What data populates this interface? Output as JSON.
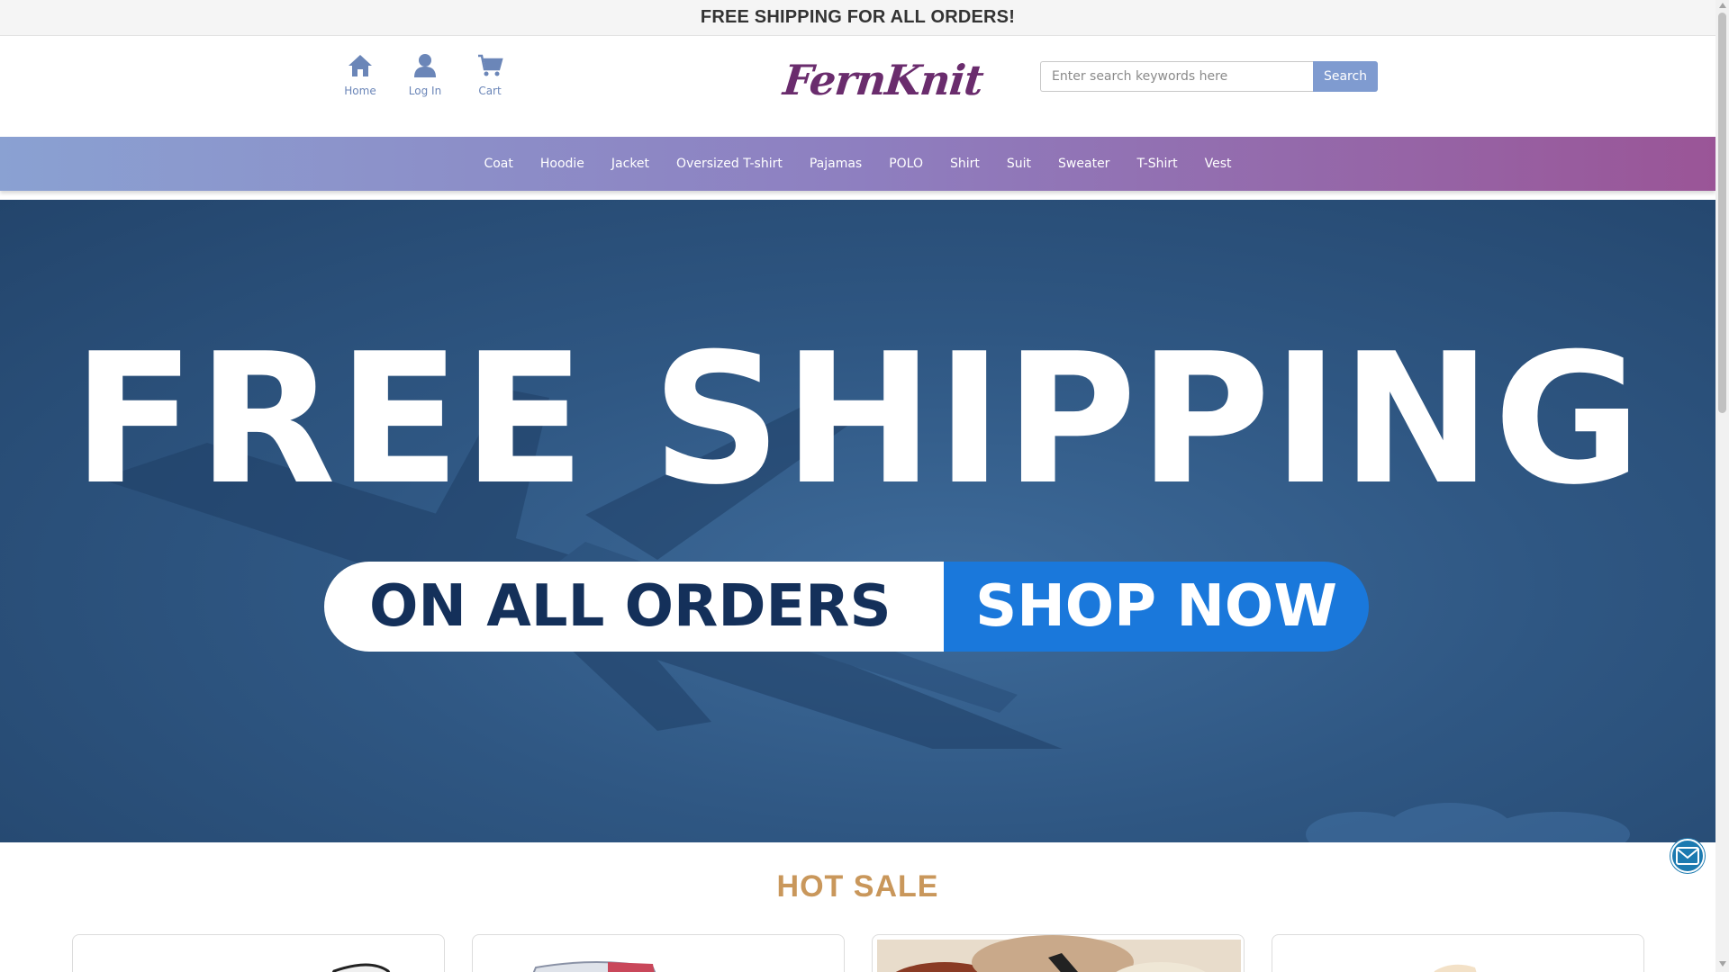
{
  "announcement": "FREE SHIPPING FOR ALL ORDERS!",
  "nav_icons": [
    {
      "label": "Home",
      "icon": "home-icon"
    },
    {
      "label": "Log In",
      "icon": "user-icon"
    },
    {
      "label": "Cart",
      "icon": "cart-icon"
    }
  ],
  "brand": {
    "logo_text": "FernKnit"
  },
  "search": {
    "placeholder": "Enter search keywords here",
    "value": "",
    "button_label": "Search"
  },
  "categories": [
    "Coat",
    "Hoodie",
    "Jacket",
    "Oversized T-shirt",
    "Pajamas",
    "POLO",
    "Shirt",
    "Suit",
    "Sweater",
    "T-Shirt",
    "Vest"
  ],
  "banner": {
    "headline": "FREE SHIPPING",
    "subline": "ON ALL ORDERS",
    "cta": "SHOP NOW"
  },
  "hot_sale": {
    "title": "HOT SALE"
  },
  "colors": {
    "accent": "#7f9bd0",
    "nav_gradient_start": "#8aa1d2",
    "nav_gradient_end": "#9a5597",
    "hot_sale_title": "#c9975b",
    "cta_blue": "#1a78db",
    "logo": "#6a2c6d"
  },
  "chat_widget": {
    "icon": "mail-icon"
  }
}
